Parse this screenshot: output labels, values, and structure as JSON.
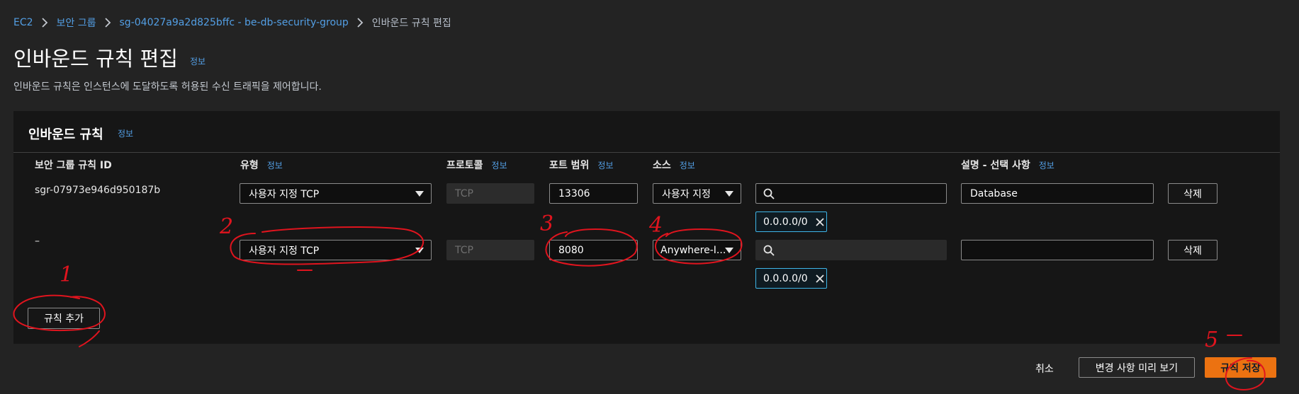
{
  "breadcrumb": {
    "items": [
      "EC2",
      "보안 그룹",
      "sg-04027a9a2d825bffc - be-db-security-group"
    ],
    "current": "인바운드 규칙 편집"
  },
  "page": {
    "title": "인바운드 규칙 편집",
    "info": "정보",
    "description": "인바운드 규칙은 인스턴스에 도달하도록 허용된 수신 트래픽을 제어합니다."
  },
  "panel": {
    "header": "인바운드 규칙",
    "info": "정보",
    "columns": {
      "rule_id": "보안 그룹 규칙 ID",
      "type": "유형",
      "protocol": "프로토콜",
      "port": "포트 범위",
      "source": "소스",
      "description": "설명 - 선택 사항",
      "info": "정보"
    },
    "rows": [
      {
        "rule_id": "sgr-07973e946d950187b",
        "type": "사용자 지정 TCP",
        "protocol": "TCP",
        "port": "13306",
        "source": "사용자 지정",
        "source_token": "0.0.0.0/0",
        "description": "Database",
        "delete": "삭제"
      },
      {
        "rule_id": "–",
        "type": "사용자 지정 TCP",
        "protocol": "TCP",
        "port": "8080",
        "source": "Anywhere-I...",
        "source_token": "0.0.0.0/0",
        "description": "",
        "delete": "삭제"
      }
    ],
    "add_rule": "규칙 추가"
  },
  "footer": {
    "cancel": "취소",
    "preview": "변경 사항 미리 보기",
    "save": "규칙 저장"
  },
  "annotations": [
    "1",
    "2",
    "3",
    "4",
    "5"
  ],
  "colors": {
    "background": "#232323",
    "panel": "#161616",
    "link": "#539fe5",
    "primary": "#ec7211",
    "token_border": "#3eb5e8",
    "annotation": "#e0141e"
  },
  "icons": {
    "breadcrumb_separator": "chevron-right-icon",
    "select": "caret-down-icon",
    "search": "search-icon",
    "token_remove": "close-icon"
  }
}
